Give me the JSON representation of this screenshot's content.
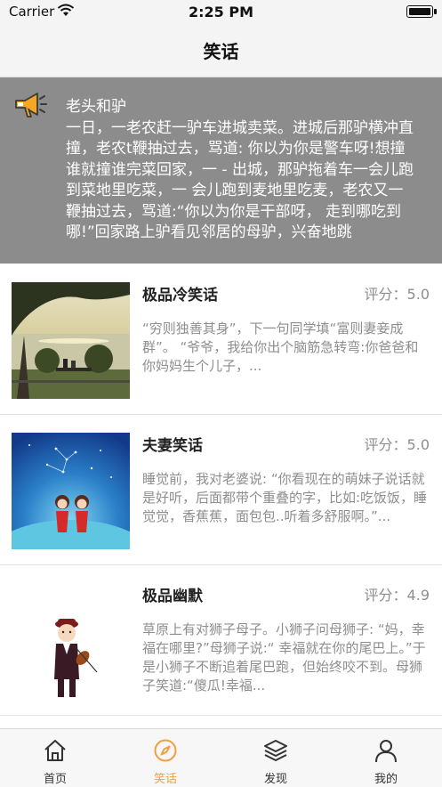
{
  "status_bar": {
    "carrier": "Carrier",
    "time": "2:25 PM",
    "battery_level": 1.0
  },
  "nav": {
    "title": "笑话"
  },
  "banner": {
    "icon": "megaphone-icon",
    "title": "老头和驴",
    "body": "一日，一老农赶一驴车进城卖菜。进城后那驴横冲直撞，老农t鞭抽过去，骂道: 你以为你是警车呀!想撞谁就撞谁完菜回家，一 - 出城，那驴拖着车一会儿跑到菜地里吃菜，一 会儿跑到麦地里吃麦，老农又一鞭抽过去，骂道:“你以为你是干部呀， 走到哪吃到哪!”回家路上驴看见邻居的母驴，兴奋地跳"
  },
  "list": [
    {
      "title": "极品冷笑话",
      "score_label": "评分：",
      "score": "5.0",
      "desc": "“穷则独善其身”，下一句同学填“富则妻妾成群”。 “爷爷，我给你出个脑筋急转弯:你爸爸和你妈妈生个儿子，...",
      "thumb": "park-lake-photo"
    },
    {
      "title": "夫妻笑话",
      "score_label": "评分：",
      "score": "5.0",
      "desc": "睡觉前，我对老婆说: “你看现在的萌妹子说话就是好听，后面都带个重叠的字，比如:吃饭饭，睡觉觉，香蕉蕉，面包包..听着多舒服啊。”...",
      "thumb": "couple-starry-night-illustration"
    },
    {
      "title": "极品幽默",
      "score_label": "评分：",
      "score": "4.9",
      "desc": "草原上有对狮子母子。小狮子问母狮子: “妈，幸福在哪里?”母狮子说:“ 幸福就在你的尾巴上。”于是小狮子不断追着尾巴跑，但始终咬不到。母狮子笑道:“傻瓜!幸福...",
      "thumb": "violinist-cartoon"
    }
  ],
  "tabs": [
    {
      "label": "首页",
      "icon": "home-icon",
      "active": false
    },
    {
      "label": "笑话",
      "icon": "compass-icon",
      "active": true
    },
    {
      "label": "发现",
      "icon": "layers-icon",
      "active": false
    },
    {
      "label": "我的",
      "icon": "user-icon",
      "active": false
    }
  ],
  "colors": {
    "accent": "#f0a040",
    "banner_bg": "#8c8c8c",
    "muted_text": "#8e8e8e"
  }
}
